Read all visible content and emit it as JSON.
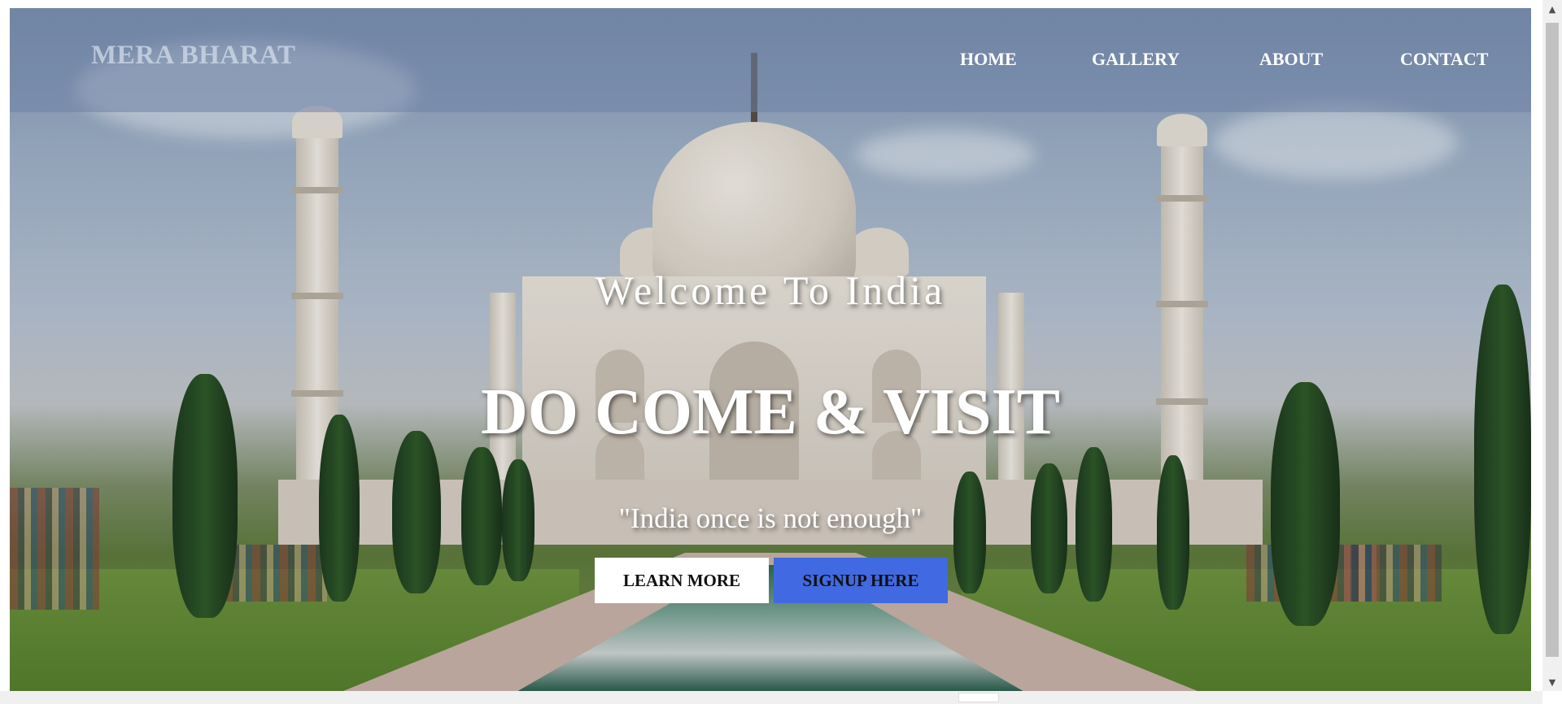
{
  "header": {
    "logo": "MERA BHARAT",
    "nav": [
      "HOME",
      "GALLERY",
      "ABOUT",
      "CONTACT"
    ]
  },
  "hero": {
    "welcome": "Welcome To India",
    "headline": "DO COME & VISIT",
    "quote": "\"India once is not enough\"",
    "buttons": {
      "learn_more": "LEARN MORE",
      "signup": "SIGNUP HERE"
    }
  },
  "colors": {
    "signup_button": "#4169e1",
    "learn_button": "#ffffff",
    "header_overlay": "rgba(110,130,165,0.55)"
  },
  "icons": {
    "scroll_up": "scroll-up-arrow-icon",
    "scroll_down": "scroll-down-arrow-icon"
  }
}
